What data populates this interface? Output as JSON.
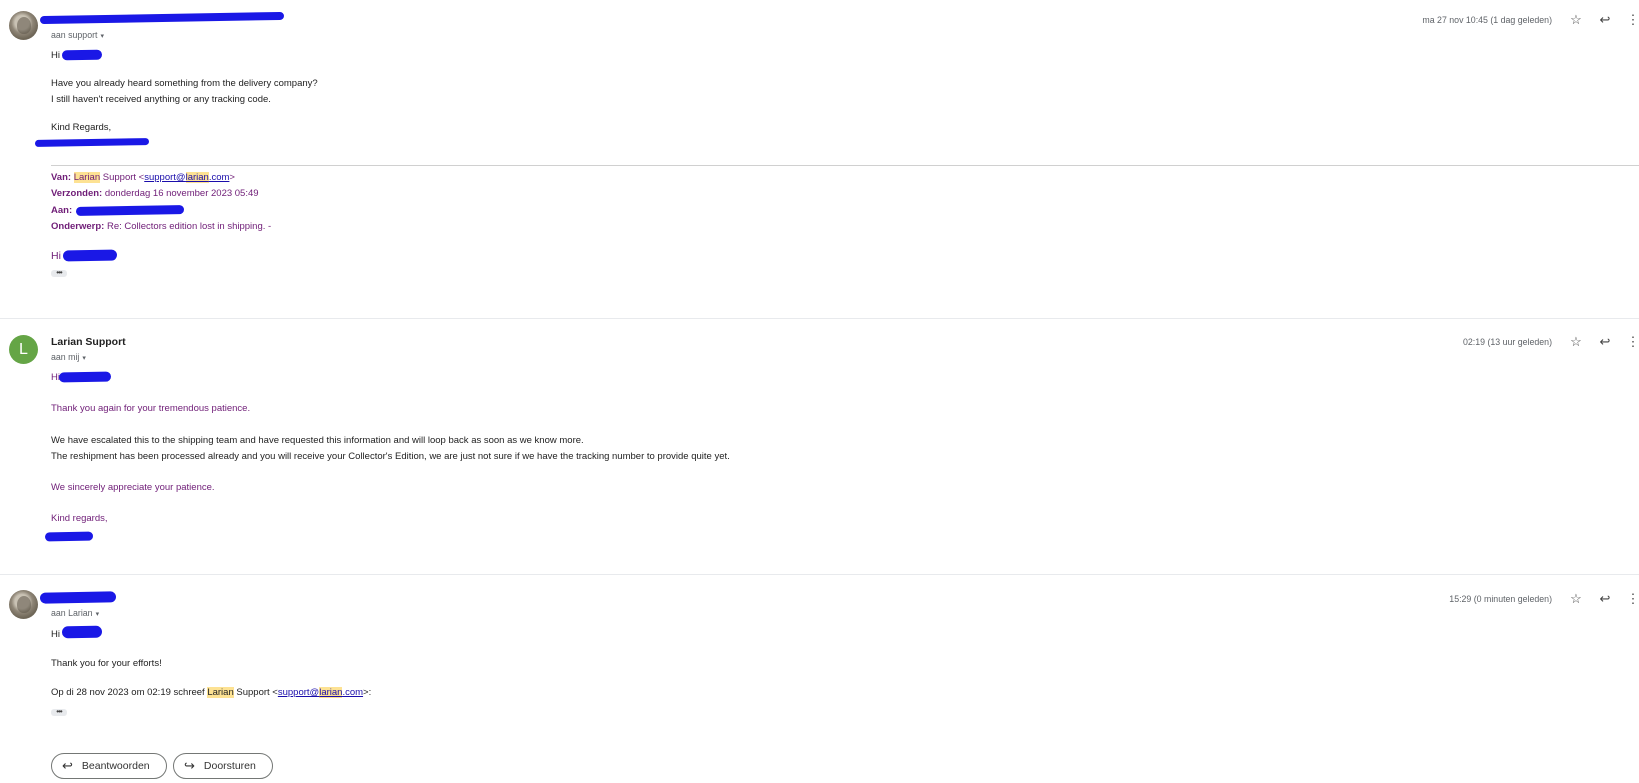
{
  "thread": [
    {
      "recipient": "aan support",
      "date": "ma 27 nov 10:45 (1 dag geleden)",
      "body": {
        "greeting": "Hi",
        "lines": [
          "Have you already heard something from the delivery company?",
          "I still haven't received anything or any tracking code."
        ],
        "closing": "Kind Regards,"
      },
      "quoted": {
        "van_label": "Van:",
        "van_name_hl": "Larian",
        "van_name_rest": " Support <",
        "van_email_a": "support@",
        "van_email_hl": "larian",
        "van_email_b": ".com",
        "van_end": ">",
        "verzonden_label": "Verzonden:",
        "verzonden_value": " donderdag 16 november 2023 05:49",
        "aan_label": "Aan:",
        "onderwerp_label": "Onderwerp:",
        "onderwerp_value": " Re: Collectors edition lost in shipping. -",
        "greeting": "Hi",
        "more": "•••"
      }
    },
    {
      "sender": "Larian Support",
      "avatar_letter": "L",
      "recipient": "aan mij",
      "date": "02:19 (13 uur geleden)",
      "body": {
        "greeting": "Hi",
        "thanks": "Thank you again for your tremendous patience.",
        "lines": [
          "We have escalated this to the shipping team and have requested this information and will loop back as soon as we know more.",
          "The reshipment has been processed already and you will receive your Collector's Edition, we are just not sure if we have the tracking number to provide quite yet."
        ],
        "appreciate": "We sincerely appreciate your patience.",
        "closing": "Kind regards,"
      }
    },
    {
      "recipient": "aan Larian",
      "date": "15:29 (0 minuten geleden)",
      "body": {
        "greeting": "Hi",
        "thanks": "Thank you for your efforts!",
        "quote_intro_a": "Op di 28 nov 2023 om 02:19 schreef ",
        "quote_intro_hl": "Larian",
        "quote_intro_b": " Support <",
        "quote_email_a": "support@",
        "quote_email_hl": "larian",
        "quote_email_b": ".com",
        "quote_intro_end": ">:",
        "more": "•••"
      }
    }
  ],
  "actions": {
    "reply_label": "Beantwoorden",
    "forward_label": "Doorsturen"
  },
  "icons": [
    "star-icon",
    "reply-icon",
    "more-vert-icon",
    "caret-down-icon",
    "forward-icon"
  ]
}
